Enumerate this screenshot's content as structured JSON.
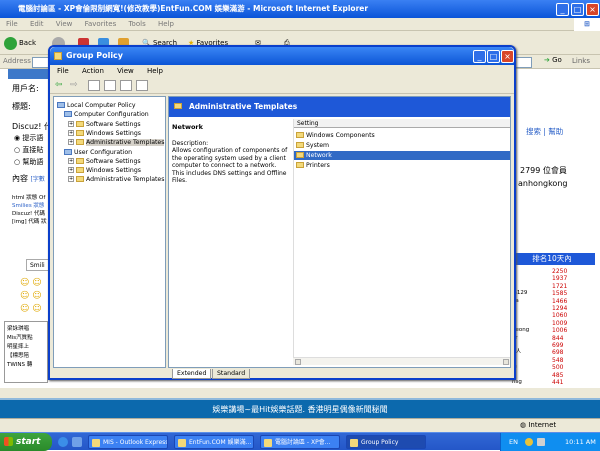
{
  "ie": {
    "title": "電腦討論區 - XP會倫限制網寬!(修改教學)EntFun.COM 娛樂滿游 - Microsoft Internet Explorer",
    "menu": [
      "File",
      "Edit",
      "View",
      "Favorites",
      "Tools",
      "Help"
    ],
    "back_label": "Back",
    "search_label": "Search",
    "favorites_label": "Favorites",
    "address_label": "Address",
    "go_label": "Go",
    "links_label": "Links",
    "status_text": "Internet"
  },
  "page": {
    "labels": [
      "用戶名:",
      "標題:",
      "Discuz! 代",
      "內容"
    ],
    "radio_labels": [
      "提示語",
      "直接貼",
      "幫助語"
    ],
    "content_hint": "[字數",
    "side_text": [
      "html 狀態 Of",
      "Smilies 狀態",
      "Discuz! 代碼",
      "[img] 代碼 狀"
    ],
    "smilies_label": "Smili",
    "nav_search": "搜索",
    "nav_help": "幫助",
    "members_text": "2799 位會員",
    "member_name": "anhongkong",
    "rank_title": "排名10天內",
    "rank_values": [
      "2250",
      "1937",
      "1721",
      "1585",
      "1466",
      "1294",
      "1060",
      "1009",
      "1006",
      "844",
      "699",
      "698",
      "548",
      "500",
      "485",
      "441"
    ],
    "rank_names": [
      "0",
      "",
      "",
      "la129",
      "aa",
      "",
      "",
      "",
      "heong",
      "ar",
      "",
      "ff人",
      "",
      "ie",
      "",
      "nsg"
    ],
    "list_items": [
      "梁詠琪唱",
      "Mis汽質點",
      "明星摔上",
      "【標思陪",
      "TWINS 轉"
    ],
    "banner": "娛樂講場~最Hit娛樂話題. 香港明星偶像新聞秘聞"
  },
  "group_policy": {
    "title": "Group Policy",
    "menu": [
      "File",
      "Action",
      "View",
      "Help"
    ],
    "tree": [
      {
        "label": "Local Computer Policy",
        "level": 0
      },
      {
        "label": "Computer Configuration",
        "level": 1
      },
      {
        "label": "Software Settings",
        "level": 2
      },
      {
        "label": "Windows Settings",
        "level": 2
      },
      {
        "label": "Administrative Templates",
        "level": 2
      },
      {
        "label": "User Configuration",
        "level": 1
      },
      {
        "label": "Software Settings",
        "level": 2
      },
      {
        "label": "Windows Settings",
        "level": 2
      },
      {
        "label": "Administrative Templates",
        "level": 2
      }
    ],
    "selected_tree_item": "Administrative Templates",
    "pane_title": "Administrative Templates",
    "detail_title": "Network",
    "description_label": "Description:",
    "description": "Allows configuration of components of the operating system used by a client computer to connect to a network. This includes DNS settings and Offline Files.",
    "list_header": "Setting",
    "list_items": [
      "Windows Components",
      "System",
      "Network",
      "Printers"
    ],
    "selected_list_item": "Network",
    "tabs": [
      "Extended",
      "Standard"
    ]
  },
  "taskbar": {
    "start_label": "start",
    "tasks": [
      "MIS - Outlook Express",
      "EntFun.COM 娛樂滿...",
      "電腦討論區 - XP會...",
      "Group Policy"
    ],
    "active_task": "Group Policy",
    "tray_lang": "EN",
    "clock": "10:11 AM"
  },
  "colors": {
    "xp_blue": "#0a54d8",
    "selection": "#316ac5",
    "start_green": "#2a8a2a",
    "rank_red": "#cc0000"
  }
}
